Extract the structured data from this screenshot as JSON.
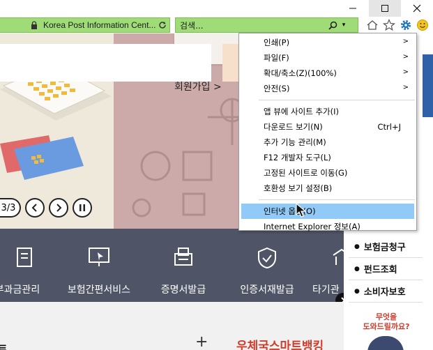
{
  "browser": {
    "address_text": "Korea Post Information Cent...",
    "search_placeholder": "검색...",
    "search_dropdown_glyph": "▾"
  },
  "page": {
    "signup_label": "회원가입",
    "signup_arrow": ">",
    "pager_count": "3/3",
    "nav_items": [
      {
        "label": "부과금관리"
      },
      {
        "label": "보험간편서비스"
      },
      {
        "label": "증명서발급"
      },
      {
        "label": "인증서재발급"
      },
      {
        "label": "타기관"
      }
    ],
    "lower_left_title": "트",
    "lower_plus": "+",
    "lower_right_title": "우체국스마트뱅킹",
    "side_menu": [
      {
        "label": "보험금청구"
      },
      {
        "label": "펀드조회"
      },
      {
        "label": "소비자보호"
      }
    ],
    "side_help_lines": [
      "무엇을",
      "도와드릴까요?"
    ]
  },
  "tools_menu": {
    "groups": [
      [
        {
          "label": "인쇄(P)",
          "submenu": true
        },
        {
          "label": "파일(F)",
          "submenu": true
        },
        {
          "label": "확대/축소(Z)(100%)",
          "submenu": true
        },
        {
          "label": "안전(S)",
          "submenu": true
        }
      ],
      [
        {
          "label": "앱 뷰에 사이트 추가(I)"
        },
        {
          "label": "다운로드 보기(N)",
          "shortcut": "Ctrl+J"
        },
        {
          "label": "추가 기능 관리(M)"
        },
        {
          "label": "F12 개발자 도구(L)"
        },
        {
          "label": "고정된 사이트로 이동(G)"
        },
        {
          "label": "호환성 보기 설정(B)"
        }
      ],
      [
        {
          "label": "인터넷 옵션(O)",
          "highlighted": true
        },
        {
          "label": "Internet Explorer 정보(A)"
        }
      ]
    ],
    "submenu_arrow": ">",
    "highlight_color": "#91c9f7"
  },
  "colors": {
    "addressbar_bg": "#9fdc78",
    "nav_band": "#4f5566",
    "banner_pink": "#ccaaaa",
    "accent_red": "#d13b2a"
  }
}
